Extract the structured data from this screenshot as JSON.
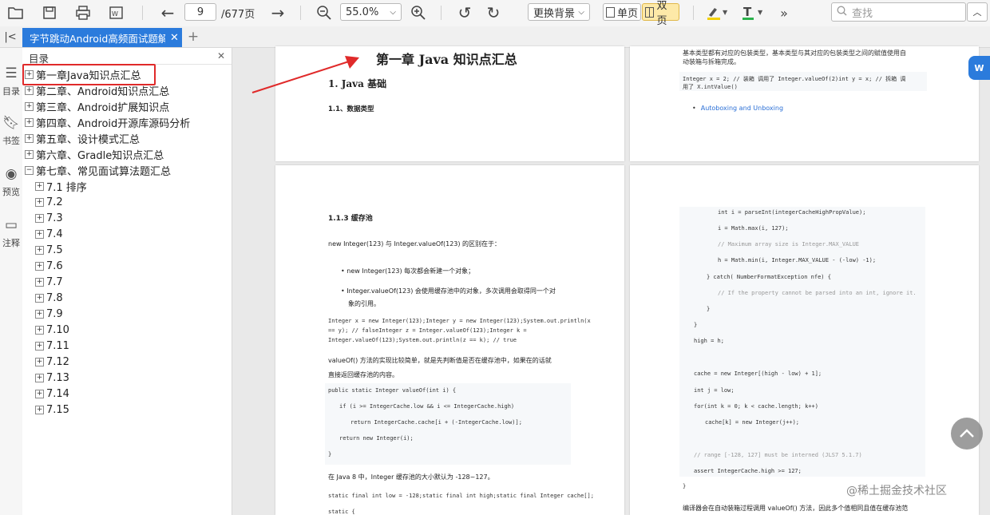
{
  "toolbar": {
    "page_input": "9",
    "page_total": "/677页",
    "zoom": "55.0%",
    "background_button": "更换背景",
    "single_page": "单页",
    "double_page": "双页",
    "search_placeholder": "查找"
  },
  "tab": {
    "title": "字节跳动Android高频面试题解",
    "add": "+"
  },
  "rail": {
    "items": [
      "目录",
      "书签",
      "预览",
      "注释"
    ]
  },
  "toc": {
    "header": "目录",
    "items": [
      "第一章Java知识点汇总",
      "第二章、Android知识点汇总",
      "第三章、Android扩展知识点",
      "第四章、Android开源库源码分析",
      "第五章、设计模式汇总",
      "第六章、Gradle知识点汇总",
      "第七章、常见面试算法题汇总"
    ],
    "subitems": [
      "7.1 排序",
      "7.2",
      "7.3",
      "7.4",
      "7.5",
      "7.6",
      "7.7",
      "7.8",
      "7.9",
      "7.10",
      "7.11",
      "7.12",
      "7.13",
      "7.14",
      "7.15"
    ]
  },
  "page_left_top": {
    "chapter_title": "第一章 Java 知识点汇总",
    "h2": "1. Java 基础",
    "h3": "1.1、数据类型"
  },
  "page_right_top": {
    "line1": "基本类型都有对应的包装类型，基本类型与其对应的包装类型之间的赋值使用自",
    "line2": "动装箱与拆箱完成。",
    "code1": "Integer x = 2;     // 装箱 调用了 Integer.valueOf(2)int y = x;         // 拆箱 调",
    "code2": "用了 X.intValue()",
    "link": "Autoboxing and Unboxing"
  },
  "page_left_bottom": {
    "h3": "1.1.3 缓存池",
    "p1": "new Integer(123) 与 Integer.valueOf(123) 的区别在于：",
    "b1": "new Integer(123) 每次都会新建一个对象；",
    "b2a": "Integer.valueOf(123) 会使用缓存池中的对象，多次调用会取得同一个对",
    "b2b": "象的引用。",
    "c1": "Integer x = new Integer(123);Integer y = new Integer(123);System.out.println(x",
    "c2": "== y);    // falseInteger z = Integer.valueOf(123);Integer k =",
    "c3": "Integer.valueOf(123);System.out.println(z == k);   // true",
    "p2a": "valueOf() 方法的实现比较简单，就是先判断值是否在缓存池中，如果在的话就",
    "p2b": "直接返回缓存池的内容。",
    "d1": "public static Integer valueOf(int i) {",
    "d2": "if (i >= IntegerCache.low && i <= IntegerCache.high)",
    "d3": "return IntegerCache.cache[i + (-IntegerCache.low)];",
    "d4": "return new Integer(i);",
    "d5": "}",
    "p3": "在 Java 8 中，Integer 缓存池的大小默认为 -128~127。",
    "e1": "static final int low = -128;static final int high;static final Integer cache[];",
    "e2": "static {"
  },
  "page_right_bottom": {
    "l1": "int i = parseInt(integerCacheHighPropValue);",
    "l2": "i = Math.max(i, 127);",
    "l3": "// Maximum array size is Integer.MAX_VALUE",
    "l4": "h = Math.min(i, Integer.MAX_VALUE - (-low) -1);",
    "l5": "} catch( NumberFormatException nfe) {",
    "l6": "// If the property cannot be parsed into an int, ignore it.",
    "l7": "}",
    "l8": "}",
    "l9": "high = h;",
    "l10": "cache = new Integer[(high - low) + 1];",
    "l11": "int j = low;",
    "l12": "for(int k = 0; k < cache.length; k++)",
    "l13": "cache[k] = new Integer(j++);",
    "l14": "// range [-128, 127] must be interned (JLS7 5.1.7)",
    "l15": "assert IntegerCache.high >= 127;",
    "l16": "}",
    "bottom": "编译器会在自动装箱过程调用 valueOf() 方法，因此多个值相同且值在缓存池范"
  },
  "watermark": "@稀土掘金技术社区",
  "colors": {
    "accent": "#2b7bdc",
    "annotation_red": "#e02a2a",
    "link": "#2a6fd6"
  }
}
